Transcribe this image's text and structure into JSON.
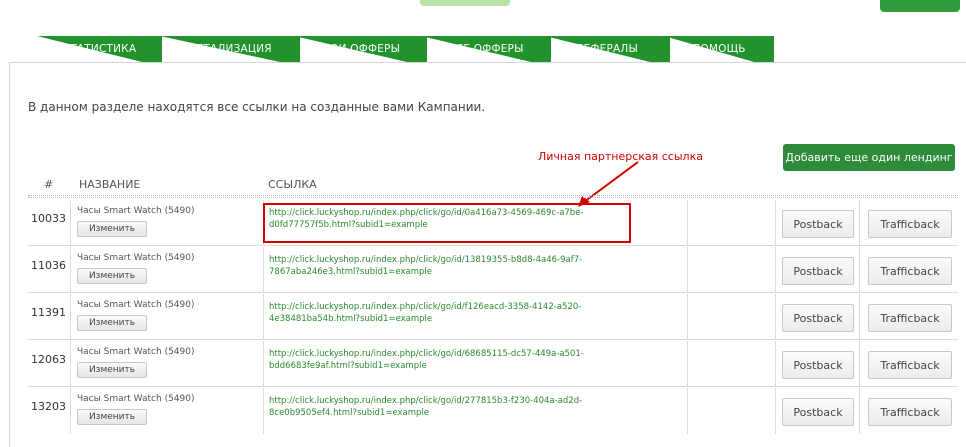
{
  "tabs": [
    "СТАТИСТИКА",
    "ДЕТАЛИЗАЦИЯ",
    "МОИ ОФФЕРЫ",
    "ВСЕ ОФФЕРЫ",
    "РЕФЕРАЛЫ",
    "ПОМОЩЬ"
  ],
  "intro_text": "В данном разделе находятся все ссылки на созданные вами Кампании.",
  "add_button_label": "Добавить еще один лендинг",
  "annotation_text": "Личная партнерская ссылка",
  "table": {
    "headers": {
      "hash": "#",
      "name": "НАЗВАНИЕ",
      "link": "ССЫЛКА"
    },
    "edit_label": "Изменить",
    "postback_label": "Postback",
    "trafficback_label": "Trafficback",
    "rows": [
      {
        "id": "10033",
        "name": "Часы Smart Watch (5490)",
        "link_1": "http://click.luckyshop.ru/index.php/click/go/id/0a416a73-4569-469c-a7be-",
        "link_2": "d0fd77757f5b.html?subid1=example"
      },
      {
        "id": "11036",
        "name": "Часы Smart Watch (5490)",
        "link_1": "http://click.luckyshop.ru/index.php/click/go/id/13819355-b8d8-4a46-9af7-",
        "link_2": "7867aba246e3.html?subid1=example"
      },
      {
        "id": "11391",
        "name": "Часы Smart Watch (5490)",
        "link_1": "http://click.luckyshop.ru/index.php/click/go/id/f126eacd-3358-4142-a520-",
        "link_2": "4e38481ba54b.html?subid1=example"
      },
      {
        "id": "12063",
        "name": "Часы Smart Watch (5490)",
        "link_1": "http://click.luckyshop.ru/index.php/click/go/id/68685115-dc57-449a-a501-",
        "link_2": "bdd6683fe9af.html?subid1=example"
      },
      {
        "id": "13203",
        "name": "Часы Smart Watch (5490)",
        "link_1": "http://click.luckyshop.ru/index.php/click/go/id/277815b3-f230-404a-ad2d-",
        "link_2": "8ce0b9505ef4.html?subid1=example"
      }
    ]
  },
  "colors": {
    "tab_green": "#22922d",
    "button_green": "#2e8b3a",
    "link_green": "#2b8a2e",
    "annotation_red": "#d40000"
  }
}
